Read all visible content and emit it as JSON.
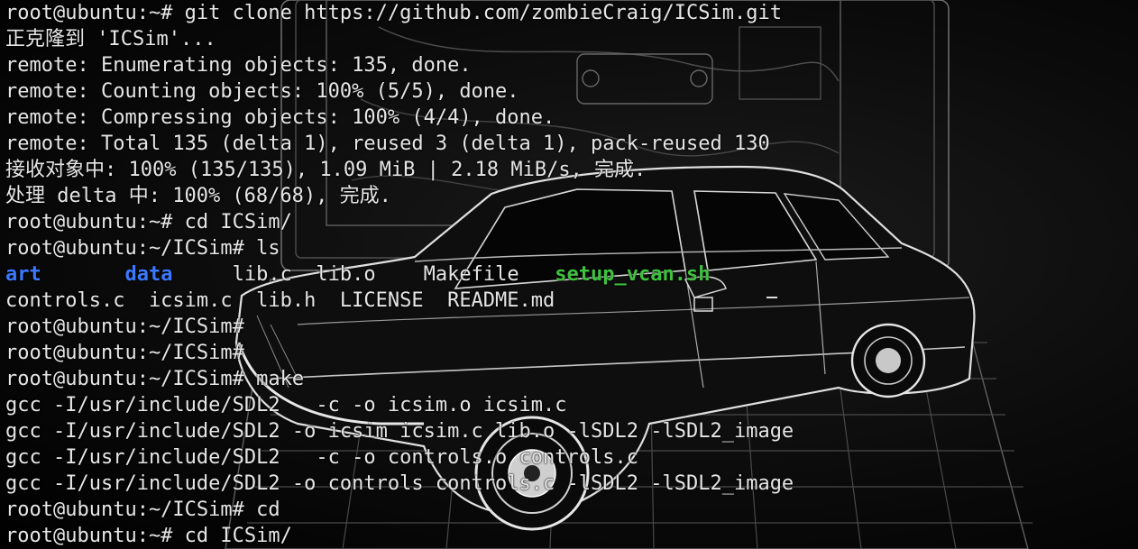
{
  "terminal": {
    "lines": [
      "root@ubuntu:~# git clone https://github.com/zombieCraig/ICSim.git",
      "正克隆到 'ICSim'...",
      "remote: Enumerating objects: 135, done.",
      "remote: Counting objects: 100% (5/5), done.",
      "remote: Compressing objects: 100% (4/4), done.",
      "remote: Total 135 (delta 1), reused 3 (delta 1), pack-reused 130",
      "接收对象中: 100% (135/135), 1.09 MiB | 2.18 MiB/s, 完成.",
      "处理 delta 中: 100% (68/68), 完成.",
      "root@ubuntu:~# cd ICSim/",
      "root@ubuntu:~/ICSim# ls",
      "",
      "controls.c  icsim.c  lib.h  LICENSE  README.md",
      "root@ubuntu:~/ICSim#",
      "root@ubuntu:~/ICSim#",
      "root@ubuntu:~/ICSim# make",
      "gcc -I/usr/include/SDL2   -c -o icsim.o icsim.c",
      "gcc -I/usr/include/SDL2 -o icsim icsim.c lib.o -lSDL2 -lSDL2_image",
      "gcc -I/usr/include/SDL2   -c -o controls.o controls.c",
      "gcc -I/usr/include/SDL2 -o controls controls.c -lSDL2 -lSDL2_image",
      "root@ubuntu:~/ICSim# cd",
      "root@ubuntu:~# cd ICSim/"
    ],
    "ls_row": [
      {
        "text": "art",
        "kind": "dir"
      },
      {
        "text": "       ",
        "kind": "plain"
      },
      {
        "text": "data",
        "kind": "dir"
      },
      {
        "text": "     lib.c  lib.o    Makefile   ",
        "kind": "plain"
      },
      {
        "text": "setup_vcan.sh",
        "kind": "exec"
      }
    ]
  },
  "colors": {
    "background": "#000000",
    "text": "#e6e6e6",
    "directory": "#3b78ff",
    "executable": "#3fc13f"
  },
  "background_image": {
    "subject": "black-and-white line art of a vintage sedan in front of a laptop",
    "icons": [
      "car-illustration",
      "laptop-illustration"
    ]
  }
}
